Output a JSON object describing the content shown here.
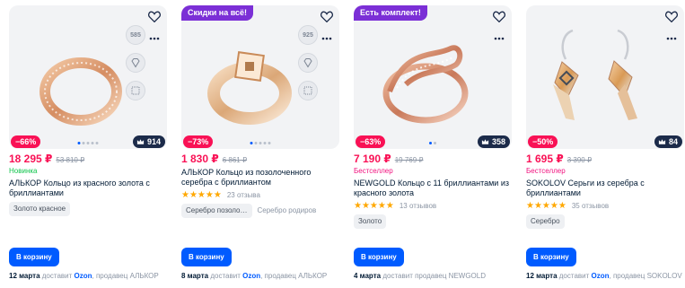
{
  "cards": [
    {
      "promo": "",
      "features": [
        "585"
      ],
      "discount": "−66%",
      "rating": "914",
      "price": "18 295 ₽",
      "old_price": "53 810 ₽",
      "tag": "Новинка",
      "title": "АЛЬКОР Кольцо из красного золота с бриллиантами",
      "stars": "",
      "reviews": "",
      "chips": [
        "Золото красное"
      ],
      "cart": "В корзину",
      "delivery_date": "12 марта",
      "delivery_text": "доставит",
      "delivery_brand": "Ozon",
      "delivery_seller": ", продавец АЛЬКОР"
    },
    {
      "promo": "Скидки на всё!",
      "features": [
        "925"
      ],
      "discount": "−73%",
      "rating": "",
      "price": "1 830 ₽",
      "old_price": "6 861 ₽",
      "tag": "",
      "title": "АЛЬКОР Кольцо из позолоченного серебра с бриллиантом",
      "stars": "★★★★★",
      "reviews": "23 отзыва",
      "chips": [
        "Серебро позоло…",
        "Серебро родиров"
      ],
      "cart": "В корзину",
      "delivery_date": "8 марта",
      "delivery_text": "доставит",
      "delivery_brand": "Ozon",
      "delivery_seller": ", продавец АЛЬКОР"
    },
    {
      "promo": "Есть комплект!",
      "features": [],
      "discount": "−63%",
      "rating": "358",
      "price": "7 190 ₽",
      "old_price": "19 769 ₽",
      "tag": "Бестселлер",
      "title": "NEWGOLD Кольцо с 11 бриллиантами из красного золота",
      "stars": "★★★★★",
      "reviews": "13 отзывов",
      "chips": [
        "Золото"
      ],
      "cart": "В корзину",
      "delivery_date": "4 марта",
      "delivery_text": "доставит продавец NEWGOLD",
      "delivery_brand": "",
      "delivery_seller": ""
    },
    {
      "promo": "",
      "features": [],
      "discount": "−50%",
      "rating": "84",
      "price": "1 695 ₽",
      "old_price": "3 390 ₽",
      "tag": "Бестселлер",
      "title": "SOKOLOV Серьги из серебра с бриллиантами",
      "stars": "★★★★★",
      "reviews": "35 отзывов",
      "chips": [
        "Серебро"
      ],
      "cart": "В корзину",
      "delivery_date": "12 марта",
      "delivery_text": "доставит",
      "delivery_brand": "Ozon",
      "delivery_seller": ", продавец SOKOLOV"
    }
  ],
  "icons": {
    "favorite": "heart-icon",
    "more": "more-icon",
    "rating": "crown-icon",
    "diamond": "diamond-icon"
  },
  "colors": {
    "price": "#f91155",
    "discount": "#f91155",
    "promo": "#7b2fd6",
    "cart": "#005bff",
    "new_tag": "#10c44c",
    "best_tag": "#f1117e",
    "star": "#ffa800"
  }
}
